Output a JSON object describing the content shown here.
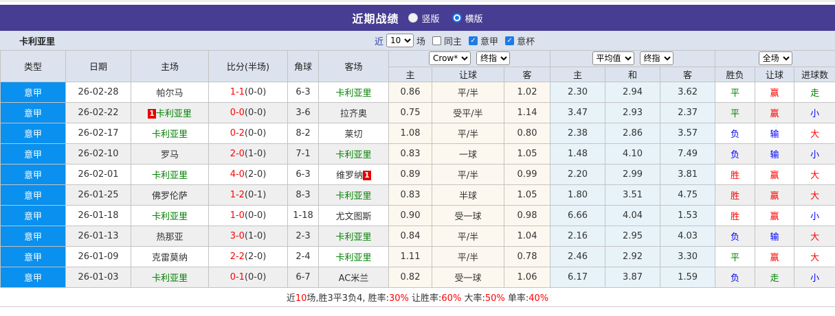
{
  "colors": {
    "accent_purple": "#473d93",
    "league_blue": "#0a90ee",
    "team_green": "#008000",
    "win_red": "#ff0000",
    "lose_blue": "#0000ff",
    "draw_green": "#008000",
    "header_bg": "#dce3ee",
    "alt_row_bg": "#efefef",
    "crown_col_bg": "#fcf8ef",
    "avg_col_bg": "#e7f3f9"
  },
  "title_bar": {
    "title": "近期战绩",
    "radio_vertical_label": "竖版",
    "radio_horizontal_label": "横版",
    "selected_layout": "横版"
  },
  "filter_bar": {
    "team": "卡利亚里",
    "near_label": "近",
    "count_value": "10",
    "unit_label": "场",
    "checkboxes": [
      {
        "label": "同主",
        "checked": false
      },
      {
        "label": "意甲",
        "checked": true
      },
      {
        "label": "意杯",
        "checked": true
      }
    ]
  },
  "table": {
    "static_headers": [
      "类型",
      "日期",
      "主场",
      "比分(半场)",
      "角球",
      "客场"
    ],
    "odds_group": {
      "selects": [
        "Crow*",
        "终指"
      ],
      "sub": [
        "主",
        "让球",
        "客"
      ]
    },
    "avg_group": {
      "selects": [
        "平均值",
        "终指"
      ],
      "sub": [
        "主",
        "和",
        "客"
      ]
    },
    "result_group": {
      "selects": [
        "全场"
      ],
      "sub": [
        "胜负",
        "让球",
        "进球数"
      ]
    },
    "rows": [
      {
        "league": "意甲",
        "date": "26-02-28",
        "home": "帕尔马",
        "home_green": false,
        "home_badge": "",
        "score": "1-1",
        "half": "(0-0)",
        "corner": "6-3",
        "away": "卡利亚里",
        "away_green": true,
        "away_badge": "",
        "crown": [
          "0.86",
          "平/半",
          "1.02"
        ],
        "avg": [
          "2.30",
          "2.94",
          "3.62"
        ],
        "results": [
          [
            "平",
            "g"
          ],
          [
            "赢",
            "r"
          ],
          [
            "走",
            "g"
          ]
        ]
      },
      {
        "league": "意甲",
        "date": "26-02-22",
        "home": "卡利亚里",
        "home_green": true,
        "home_badge": "1",
        "score": "0-0",
        "half": "(0-0)",
        "corner": "3-6",
        "away": "拉齐奥",
        "away_green": false,
        "away_badge": "",
        "crown": [
          "0.75",
          "受平/半",
          "1.14"
        ],
        "avg": [
          "3.47",
          "2.93",
          "2.37"
        ],
        "results": [
          [
            "平",
            "g"
          ],
          [
            "赢",
            "r"
          ],
          [
            "小",
            "b"
          ]
        ]
      },
      {
        "league": "意甲",
        "date": "26-02-17",
        "home": "卡利亚里",
        "home_green": true,
        "home_badge": "",
        "score": "0-2",
        "half": "(0-0)",
        "corner": "8-2",
        "away": "莱切",
        "away_green": false,
        "away_badge": "",
        "crown": [
          "1.08",
          "平/半",
          "0.80"
        ],
        "avg": [
          "2.38",
          "2.86",
          "3.57"
        ],
        "results": [
          [
            "负",
            "b"
          ],
          [
            "输",
            "b"
          ],
          [
            "大",
            "r"
          ]
        ]
      },
      {
        "league": "意甲",
        "date": "26-02-10",
        "home": "罗马",
        "home_green": false,
        "home_badge": "",
        "score": "2-0",
        "half": "(1-0)",
        "corner": "7-1",
        "away": "卡利亚里",
        "away_green": true,
        "away_badge": "",
        "crown": [
          "0.83",
          "一球",
          "1.05"
        ],
        "avg": [
          "1.48",
          "4.10",
          "7.49"
        ],
        "results": [
          [
            "负",
            "b"
          ],
          [
            "输",
            "b"
          ],
          [
            "小",
            "b"
          ]
        ]
      },
      {
        "league": "意甲",
        "date": "26-02-01",
        "home": "卡利亚里",
        "home_green": true,
        "home_badge": "",
        "score": "4-0",
        "half": "(2-0)",
        "corner": "6-3",
        "away": "维罗纳",
        "away_green": false,
        "away_badge": "1",
        "crown": [
          "0.89",
          "平/半",
          "0.99"
        ],
        "avg": [
          "2.20",
          "2.99",
          "3.81"
        ],
        "results": [
          [
            "胜",
            "r"
          ],
          [
            "赢",
            "r"
          ],
          [
            "大",
            "r"
          ]
        ]
      },
      {
        "league": "意甲",
        "date": "26-01-25",
        "home": "佛罗伦萨",
        "home_green": false,
        "home_badge": "",
        "score": "1-2",
        "half": "(0-1)",
        "corner": "8-3",
        "away": "卡利亚里",
        "away_green": true,
        "away_badge": "",
        "crown": [
          "0.83",
          "半球",
          "1.05"
        ],
        "avg": [
          "1.80",
          "3.51",
          "4.75"
        ],
        "results": [
          [
            "胜",
            "r"
          ],
          [
            "赢",
            "r"
          ],
          [
            "大",
            "r"
          ]
        ]
      },
      {
        "league": "意甲",
        "date": "26-01-18",
        "home": "卡利亚里",
        "home_green": true,
        "home_badge": "",
        "score": "1-0",
        "half": "(0-0)",
        "corner": "1-18",
        "away": "尤文图斯",
        "away_green": false,
        "away_badge": "",
        "crown": [
          "0.90",
          "受一球",
          "0.98"
        ],
        "avg": [
          "6.66",
          "4.04",
          "1.53"
        ],
        "results": [
          [
            "胜",
            "r"
          ],
          [
            "赢",
            "r"
          ],
          [
            "小",
            "b"
          ]
        ]
      },
      {
        "league": "意甲",
        "date": "26-01-13",
        "home": "热那亚",
        "home_green": false,
        "home_badge": "",
        "score": "3-0",
        "half": "(1-0)",
        "corner": "2-3",
        "away": "卡利亚里",
        "away_green": true,
        "away_badge": "",
        "crown": [
          "0.84",
          "平/半",
          "1.04"
        ],
        "avg": [
          "2.16",
          "2.95",
          "4.03"
        ],
        "results": [
          [
            "负",
            "b"
          ],
          [
            "输",
            "b"
          ],
          [
            "大",
            "r"
          ]
        ]
      },
      {
        "league": "意甲",
        "date": "26-01-09",
        "home": "克雷莫纳",
        "home_green": false,
        "home_badge": "",
        "score": "2-2",
        "half": "(2-0)",
        "corner": "2-4",
        "away": "卡利亚里",
        "away_green": true,
        "away_badge": "",
        "crown": [
          "1.11",
          "平/半",
          "0.78"
        ],
        "avg": [
          "2.46",
          "2.92",
          "3.30"
        ],
        "results": [
          [
            "平",
            "g"
          ],
          [
            "赢",
            "r"
          ],
          [
            "大",
            "r"
          ]
        ]
      },
      {
        "league": "意甲",
        "date": "26-01-03",
        "home": "卡利亚里",
        "home_green": true,
        "home_badge": "",
        "score": "0-1",
        "half": "(0-0)",
        "corner": "6-7",
        "away": "AC米兰",
        "away_green": false,
        "away_badge": "",
        "crown": [
          "0.82",
          "受一球",
          "1.06"
        ],
        "avg": [
          "6.17",
          "3.87",
          "1.59"
        ],
        "results": [
          [
            "负",
            "b"
          ],
          [
            "走",
            "g"
          ],
          [
            "小",
            "b"
          ]
        ]
      }
    ]
  },
  "footer": {
    "segments": [
      [
        "近",
        "k"
      ],
      [
        "10",
        "r"
      ],
      [
        "场,胜3平3负4, 胜率:",
        "k"
      ],
      [
        "30%",
        "r"
      ],
      [
        " 让胜率:",
        "k"
      ],
      [
        "60%",
        "r"
      ],
      [
        " 大率:",
        "k"
      ],
      [
        "50%",
        "r"
      ],
      [
        " 单率:",
        "k"
      ],
      [
        "40%",
        "r"
      ]
    ]
  }
}
